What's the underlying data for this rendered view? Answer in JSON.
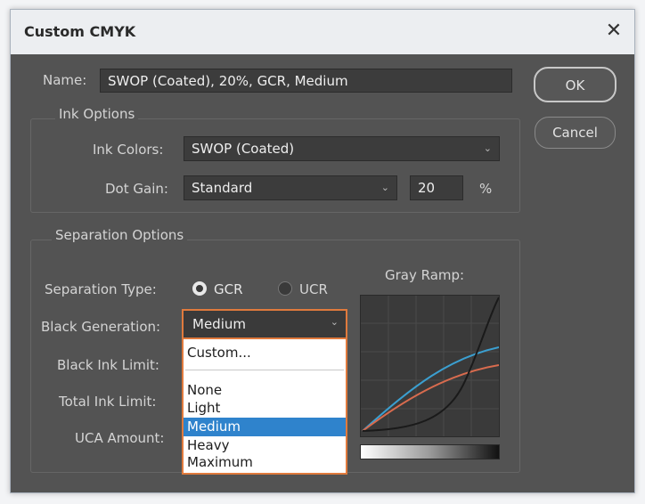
{
  "dialog": {
    "title": "Custom CMYK",
    "close_glyph": "✕"
  },
  "name": {
    "label": "Name:",
    "value": "SWOP (Coated), 20%, GCR, Medium"
  },
  "buttons": {
    "ok": "OK",
    "cancel": "Cancel"
  },
  "ink_options": {
    "legend": "Ink Options",
    "ink_colors_label": "Ink Colors:",
    "ink_colors_value": "SWOP (Coated)",
    "dot_gain_label": "Dot Gain:",
    "dot_gain_value": "Standard",
    "dot_gain_amount": "20",
    "dot_gain_unit": "%"
  },
  "separation_options": {
    "legend": "Separation Options",
    "type_label": "Separation Type:",
    "type_options": [
      "GCR",
      "UCR"
    ],
    "type_selected": "GCR",
    "black_generation_label": "Black Generation:",
    "black_generation_value": "Medium",
    "black_ink_limit_label": "Black Ink Limit:",
    "total_ink_limit_label": "Total Ink Limit:",
    "uca_amount_label": "UCA Amount:",
    "gray_ramp_label": "Gray Ramp:"
  },
  "dropdown": {
    "items": [
      "Custom...",
      "None",
      "Light",
      "Medium",
      "Heavy",
      "Maximum"
    ],
    "selected": "Medium"
  },
  "colors": {
    "accent": "#e07a3d",
    "highlight": "#2f83cc",
    "dialog_bg": "#535353"
  },
  "icons": {
    "close": "close-icon",
    "caret": "chevron-down-icon"
  }
}
